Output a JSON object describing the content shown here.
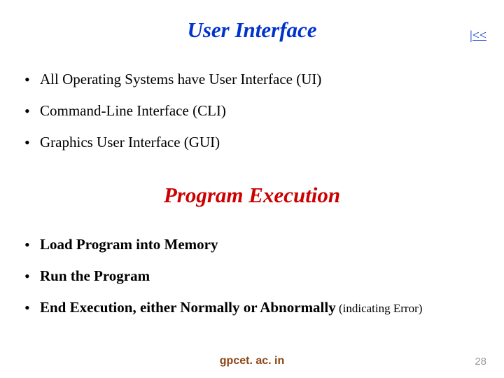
{
  "header": {
    "title1": "User Interface",
    "back_link": "|<<"
  },
  "section1": {
    "bullets": [
      "All Operating Systems have User Interface (UI)",
      "Command-Line Interface (CLI)",
      "Graphics User Interface (GUI)"
    ]
  },
  "header2": {
    "title2": "Program Execution"
  },
  "section2": {
    "bullets": [
      "Load Program into Memory",
      "Run the Program",
      "End Execution, either Normally or Abnormally"
    ],
    "error_note": " (indicating Error)"
  },
  "footer": {
    "site": "gpcet. ac. in",
    "page": "28"
  }
}
